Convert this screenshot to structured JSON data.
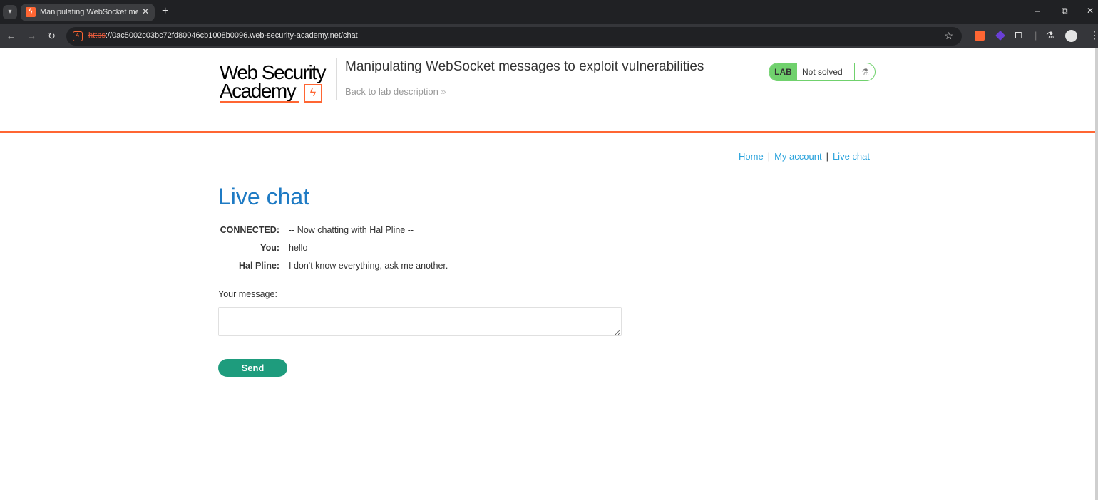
{
  "browser": {
    "tab_title": "Manipulating WebSocket messa",
    "url_scheme": "https",
    "url_rest": "://0ac5002c03bc72fd80046cb1008b0096.web-security-academy.net/chat",
    "window_controls": {
      "minimize": "–",
      "restore": "⧉",
      "close": "✕"
    }
  },
  "header": {
    "logo_line1": "Web Security",
    "logo_line2": "Academy",
    "lab_title": "Manipulating WebSocket messages to exploit vulnerabilities",
    "back_link": "Back to lab description",
    "back_chevron": "»",
    "lab_badge": "LAB",
    "lab_status": "Not solved"
  },
  "nav": {
    "home": "Home",
    "my_account": "My account",
    "live_chat": "Live chat"
  },
  "page": {
    "heading": "Live chat",
    "messages": [
      {
        "who": "CONNECTED:",
        "text": "-- Now chatting with Hal Pline --"
      },
      {
        "who": "You:",
        "text": "hello"
      },
      {
        "who": "Hal Pline:",
        "text": "I don't know everything, ask me another."
      }
    ],
    "message_label": "Your message:",
    "message_value": "",
    "send_label": "Send"
  },
  "colors": {
    "accent_orange": "#ff6633",
    "heading_blue": "#1f7bc4",
    "link_blue": "#29a2dc",
    "lab_green": "#70d16d",
    "send_green": "#1e9c7d"
  }
}
